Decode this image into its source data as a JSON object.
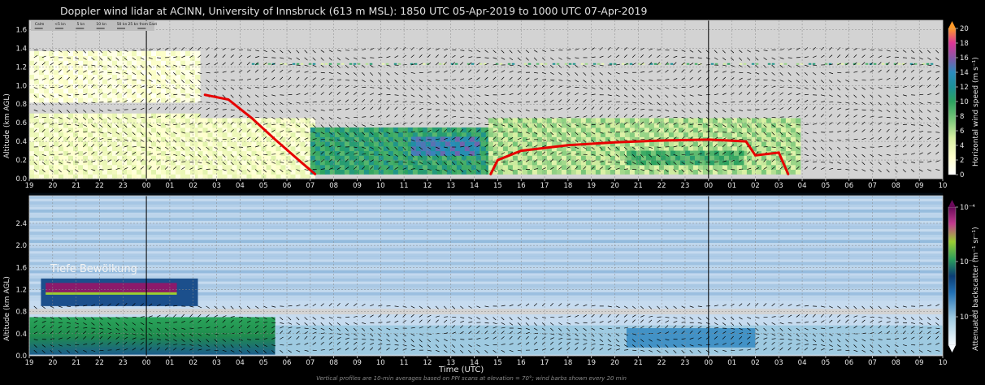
{
  "title": "Doppler wind lidar at ACINN, University of Innsbruck (613 m MSL): 1850 UTC 05-Apr-2019 to 1000 UTC 07-Apr-2019",
  "footnote": "Vertical profiles are 10-min averages based on PPI scans at elevation = 70°; wind barbs shown every 20 min",
  "annotation": "Tiefe Bewölkung",
  "colors": {
    "background": "#000000",
    "missing": "#d3d3d3",
    "annotation_line": "#e60000"
  },
  "chart_data": [
    {
      "type": "heatmap",
      "panel": "top",
      "variable": "Horizontal wind speed",
      "xlabel": "",
      "ylabel": "Altitude (km AGL)",
      "colorbar_label": "Horizontal wind speed (m s⁻¹)",
      "colorbar_ticks": [
        "0",
        "2",
        "4",
        "6",
        "8",
        "10",
        "12",
        "14",
        "16",
        "18",
        "20"
      ],
      "colorbar_range": [
        0,
        20
      ],
      "ylim": [
        0,
        1.7
      ],
      "yticks": [
        "0.0",
        "0.2",
        "0.4",
        "0.6",
        "0.8",
        "1.0",
        "1.2",
        "1.4",
        "1.6"
      ],
      "xticks": [
        "19",
        "20",
        "21",
        "22",
        "23",
        "00",
        "01",
        "02",
        "03",
        "04",
        "05",
        "06",
        "07",
        "08",
        "09",
        "10",
        "11",
        "12",
        "13",
        "14",
        "15",
        "16",
        "17",
        "18",
        "19",
        "20",
        "21",
        "22",
        "23",
        "00",
        "01",
        "02",
        "03",
        "04",
        "05",
        "06",
        "07",
        "08",
        "09",
        "10"
      ],
      "wind_barb_legend": [
        "Calm",
        "<5 kn",
        "5 kn",
        "10 kn",
        "50 kn",
        "25 kn from East"
      ],
      "red_line_segments": [
        {
          "x": [
            7.5,
            8.5,
            9.5,
            10.5,
            11.5,
            12.2
          ],
          "y": [
            0.9,
            0.85,
            0.65,
            0.42,
            0.2,
            0.05
          ]
        },
        {
          "x": [
            19.7,
            20.0,
            21,
            23,
            25,
            27,
            29,
            30.6,
            31,
            32,
            32.4
          ],
          "y": [
            0.05,
            0.2,
            0.3,
            0.36,
            0.39,
            0.41,
            0.42,
            0.4,
            0.25,
            0.28,
            0.05
          ]
        }
      ],
      "regions": [
        {
          "x": [
            0,
            7.2
          ],
          "y": [
            0.0,
            0.66
          ],
          "speed": 3
        },
        {
          "x": [
            0,
            7.2
          ],
          "y": [
            0.82,
            1.35
          ],
          "speed": 2
        },
        {
          "x": [
            7.2,
            12
          ],
          "y": [
            0.0,
            0.62
          ],
          "speed": 3
        },
        {
          "x": [
            12,
            19.6
          ],
          "y": [
            0.05,
            0.5
          ],
          "speed": 10
        },
        {
          "x": [
            16.3,
            19.2
          ],
          "y": [
            0.25,
            0.42
          ],
          "speed": 14
        },
        {
          "x": [
            19.6,
            32.8
          ],
          "y": [
            0.05,
            0.65
          ],
          "speed": 6
        },
        {
          "x": [
            25.5,
            30.3
          ],
          "y": [
            0.15,
            0.3
          ],
          "speed": 9
        }
      ]
    },
    {
      "type": "heatmap",
      "panel": "bottom",
      "variable": "Attenuated backscatter",
      "xlabel": "Time (UTC)",
      "ylabel": "Altitude (km AGL)",
      "colorbar_label": "Attenuated backscatter (m⁻¹ sr⁻¹)",
      "colorbar_ticks": [
        "10⁻⁴",
        "10⁻⁵",
        "10⁻⁶"
      ],
      "ylim": [
        0,
        2.9
      ],
      "yticks": [
        "0.0",
        "0.4",
        "0.8",
        "1.2",
        "1.6",
        "2.0",
        "2.4"
      ],
      "xticks": [
        "19",
        "20",
        "21",
        "22",
        "23",
        "00",
        "01",
        "02",
        "03",
        "04",
        "05",
        "06",
        "07",
        "08",
        "09",
        "10",
        "11",
        "12",
        "13",
        "14",
        "15",
        "16",
        "17",
        "18",
        "19",
        "20",
        "21",
        "22",
        "23",
        "00",
        "01",
        "02",
        "03",
        "04",
        "05",
        "06",
        "07",
        "08",
        "09",
        "10"
      ],
      "cloud_layer": {
        "x": [
          0.7,
          6.3
        ],
        "y": [
          1.12,
          1.32
        ]
      }
    }
  ]
}
